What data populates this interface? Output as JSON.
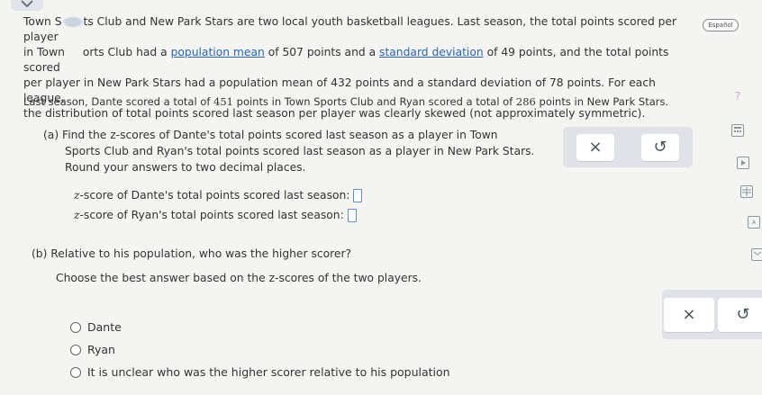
{
  "header": {
    "language_button": "Español"
  },
  "intro": {
    "line1_a": "Town S",
    "line1_b": "ts Club and New Park Stars are two local youth basketball leagues. Last season, the total points scored per player",
    "line2_a": "in Town",
    "line2_b": "orts Club had a",
    "link_mean": "population mean",
    "line2_c": "of 507 points and a",
    "link_sd": "standard deviation",
    "line2_d": "of 49 points, and the total points scored",
    "line3": "per player in New Park Stars had a population mean of 432 points and a standard deviation of 78 points. For each league,",
    "line4": "the distribution of total points scored last season per player was clearly skewed (not approximately symmetric).",
    "dante_line_a": "Last season, Dante scored a total of",
    "dante_points": "451",
    "dante_line_b": "points in Town Sports Club and Ryan scored a total of",
    "ryan_points": "286",
    "dante_line_c": "points in New Park Stars."
  },
  "part_a": {
    "line1": "(a) Find the z-scores of Dante's total points scored last season as a player in Town",
    "line2": "Sports Club and Ryan's total points scored last season as a player in New Park Stars.",
    "line3": "Round your answers to two decimal places.",
    "dante_label": "-score of Dante's total points scored last season:",
    "ryan_label": "-score of Ryan's total points scored last season:",
    "z": "z"
  },
  "part_b": {
    "question": "(b) Relative to his population, who was the higher scorer?",
    "instruction": "Choose the best answer based on the z-scores of the two players.",
    "options": [
      "Dante",
      "Ryan",
      "It is unclear who was the higher scorer relative to his population"
    ]
  },
  "buttons": {
    "clear": "×",
    "undo": "↺"
  },
  "side_icons": {
    "help": "?"
  }
}
